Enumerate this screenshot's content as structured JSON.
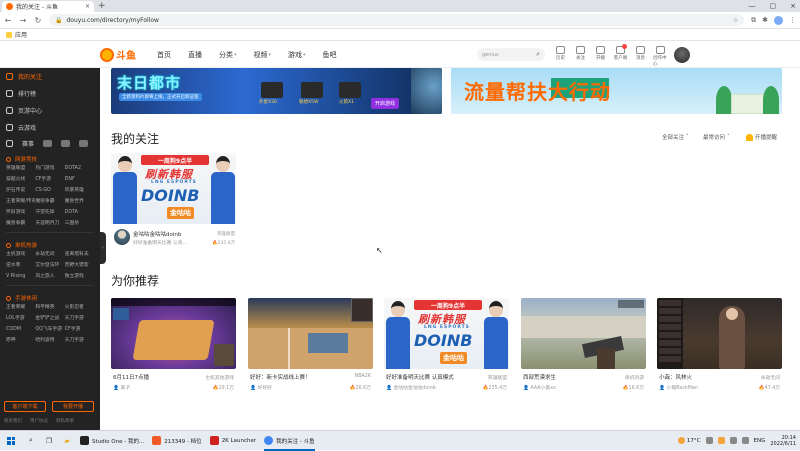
{
  "browser": {
    "tab_title": "我的关注 - 斗鱼",
    "tab_close": "×",
    "new_tab": "+",
    "url": "douyu.com/directory/myFollow",
    "bookmark_label": "应用",
    "window_controls": [
      "—",
      "▢",
      "×"
    ]
  },
  "site": {
    "logo_text": "斗鱼",
    "nav": [
      {
        "label": "首页",
        "caret": ""
      },
      {
        "label": "直播",
        "caret": ""
      },
      {
        "label": "分类",
        "caret": "▾"
      },
      {
        "label": "视频",
        "caret": "▾"
      },
      {
        "label": "游戏",
        "caret": "▾"
      },
      {
        "label": "鱼吧",
        "caret": ""
      }
    ],
    "search_placeholder": "genius",
    "user_icons": [
      "历史",
      "关注",
      "开播",
      "客户端",
      "消息",
      "创作中心"
    ]
  },
  "sidebar": {
    "items": [
      {
        "label": "我的关注",
        "active": true
      },
      {
        "label": "排行榜",
        "active": false
      },
      {
        "label": "页游中心",
        "active": false
      },
      {
        "label": "云游戏",
        "active": false
      }
    ],
    "icon_row_label": "赛事",
    "sections": [
      {
        "title": "网游竞技",
        "entries": [
          "英雄联盟",
          "热门游戏",
          "DOTA2",
          "穿越火线",
          "CF手游",
          "DNF",
          "炉石传说",
          "CS:GO",
          "风暴英雄",
          "王者荣耀/传奇",
          "魔兽争霸",
          "魔兽世界",
          "怀旧游戏",
          "守望先锋",
          "DOTA",
          "魔兽争霸",
          "天涯明月刀",
          "三国杀"
        ]
      },
      {
        "title": "单机热游",
        "entries": [
          "主机游戏",
          "永劫无间",
          "逃离塔科夫",
          "逆水寒",
          "艾尔登法环",
          "荒野大镖客",
          "V Rising",
          "风之旅人",
          "独立游戏"
        ]
      },
      {
        "title": "手游休闲",
        "entries": [
          "王者荣耀",
          "和平精英",
          "火影忍者",
          "LOL手游",
          "金铲铲之战",
          "天刀手游",
          "CODM",
          "QQ飞车手游",
          "CF手游",
          "原神",
          "哈利波特",
          "天刀手游"
        ]
      }
    ],
    "btn_download": "客户端下载",
    "btn_live": "我要开播",
    "footer": [
      "联系我们",
      "用户协议",
      "隐私政策"
    ]
  },
  "banners": {
    "left_title": "末日都市",
    "left_sub": "全新资料片即将上线，正式开启新征程",
    "left_prizes": [
      "外星X30",
      "联想X5W",
      "火箭X1"
    ],
    "left_cta": "开启游戏",
    "right_title": "流量帮扶大行动"
  },
  "follow": {
    "section_title": "我的关注",
    "sort_label": "全部关注",
    "time_label": "最常访问",
    "notify_label": "开播提醒",
    "card": {
      "thumb_top": "一周狗9点半",
      "thumb_cn": "刷新韩服",
      "thumb_esp": "LNG ESPORTS",
      "thumb_big": "DOINB",
      "thumb_tag": "金咕咕",
      "name": "金咕咕金咕咕doinb",
      "category": "英雄联盟",
      "desc": "好好准备明天比赛 认真...",
      "views": "235.4万"
    }
  },
  "recommend": {
    "section_title": "为你推荐",
    "cards": [
      {
        "title": "6月11日7点播",
        "tag": "主机其他游戏",
        "author": "美子",
        "views": "29.1万"
      },
      {
        "title": "好好：新卡实战线上赛！",
        "tag": "NBA2K",
        "author": "好好好",
        "views": "26.6万"
      },
      {
        "title": "好好准备明天比赛 认真模式",
        "tag": "英雄联盟",
        "author": "金咕咕金咕咕doinb",
        "views": "235.4万"
      },
      {
        "title": "西部荒漠求生",
        "tag": "单机热游",
        "author": "AAA小美xx",
        "views": "16.6万"
      },
      {
        "title": "小哉：风林火",
        "tag": "永劫无间",
        "author": "小哉BackMan",
        "views": "47.4万"
      }
    ]
  },
  "taskbar": {
    "apps": [
      {
        "label": "Studio One - 我的...",
        "color": "#222222",
        "active": false
      },
      {
        "label": "213349 - 档位",
        "color": "#f05a28",
        "active": false
      },
      {
        "label": "2K Launcher",
        "color": "#d02020",
        "active": false
      },
      {
        "label": "我的关注 - 斗鱼",
        "color": "#4285f4",
        "active": true
      }
    ],
    "temp": "17°C",
    "lang": "ENG",
    "time": "20:14",
    "date": "2022/6/11"
  }
}
